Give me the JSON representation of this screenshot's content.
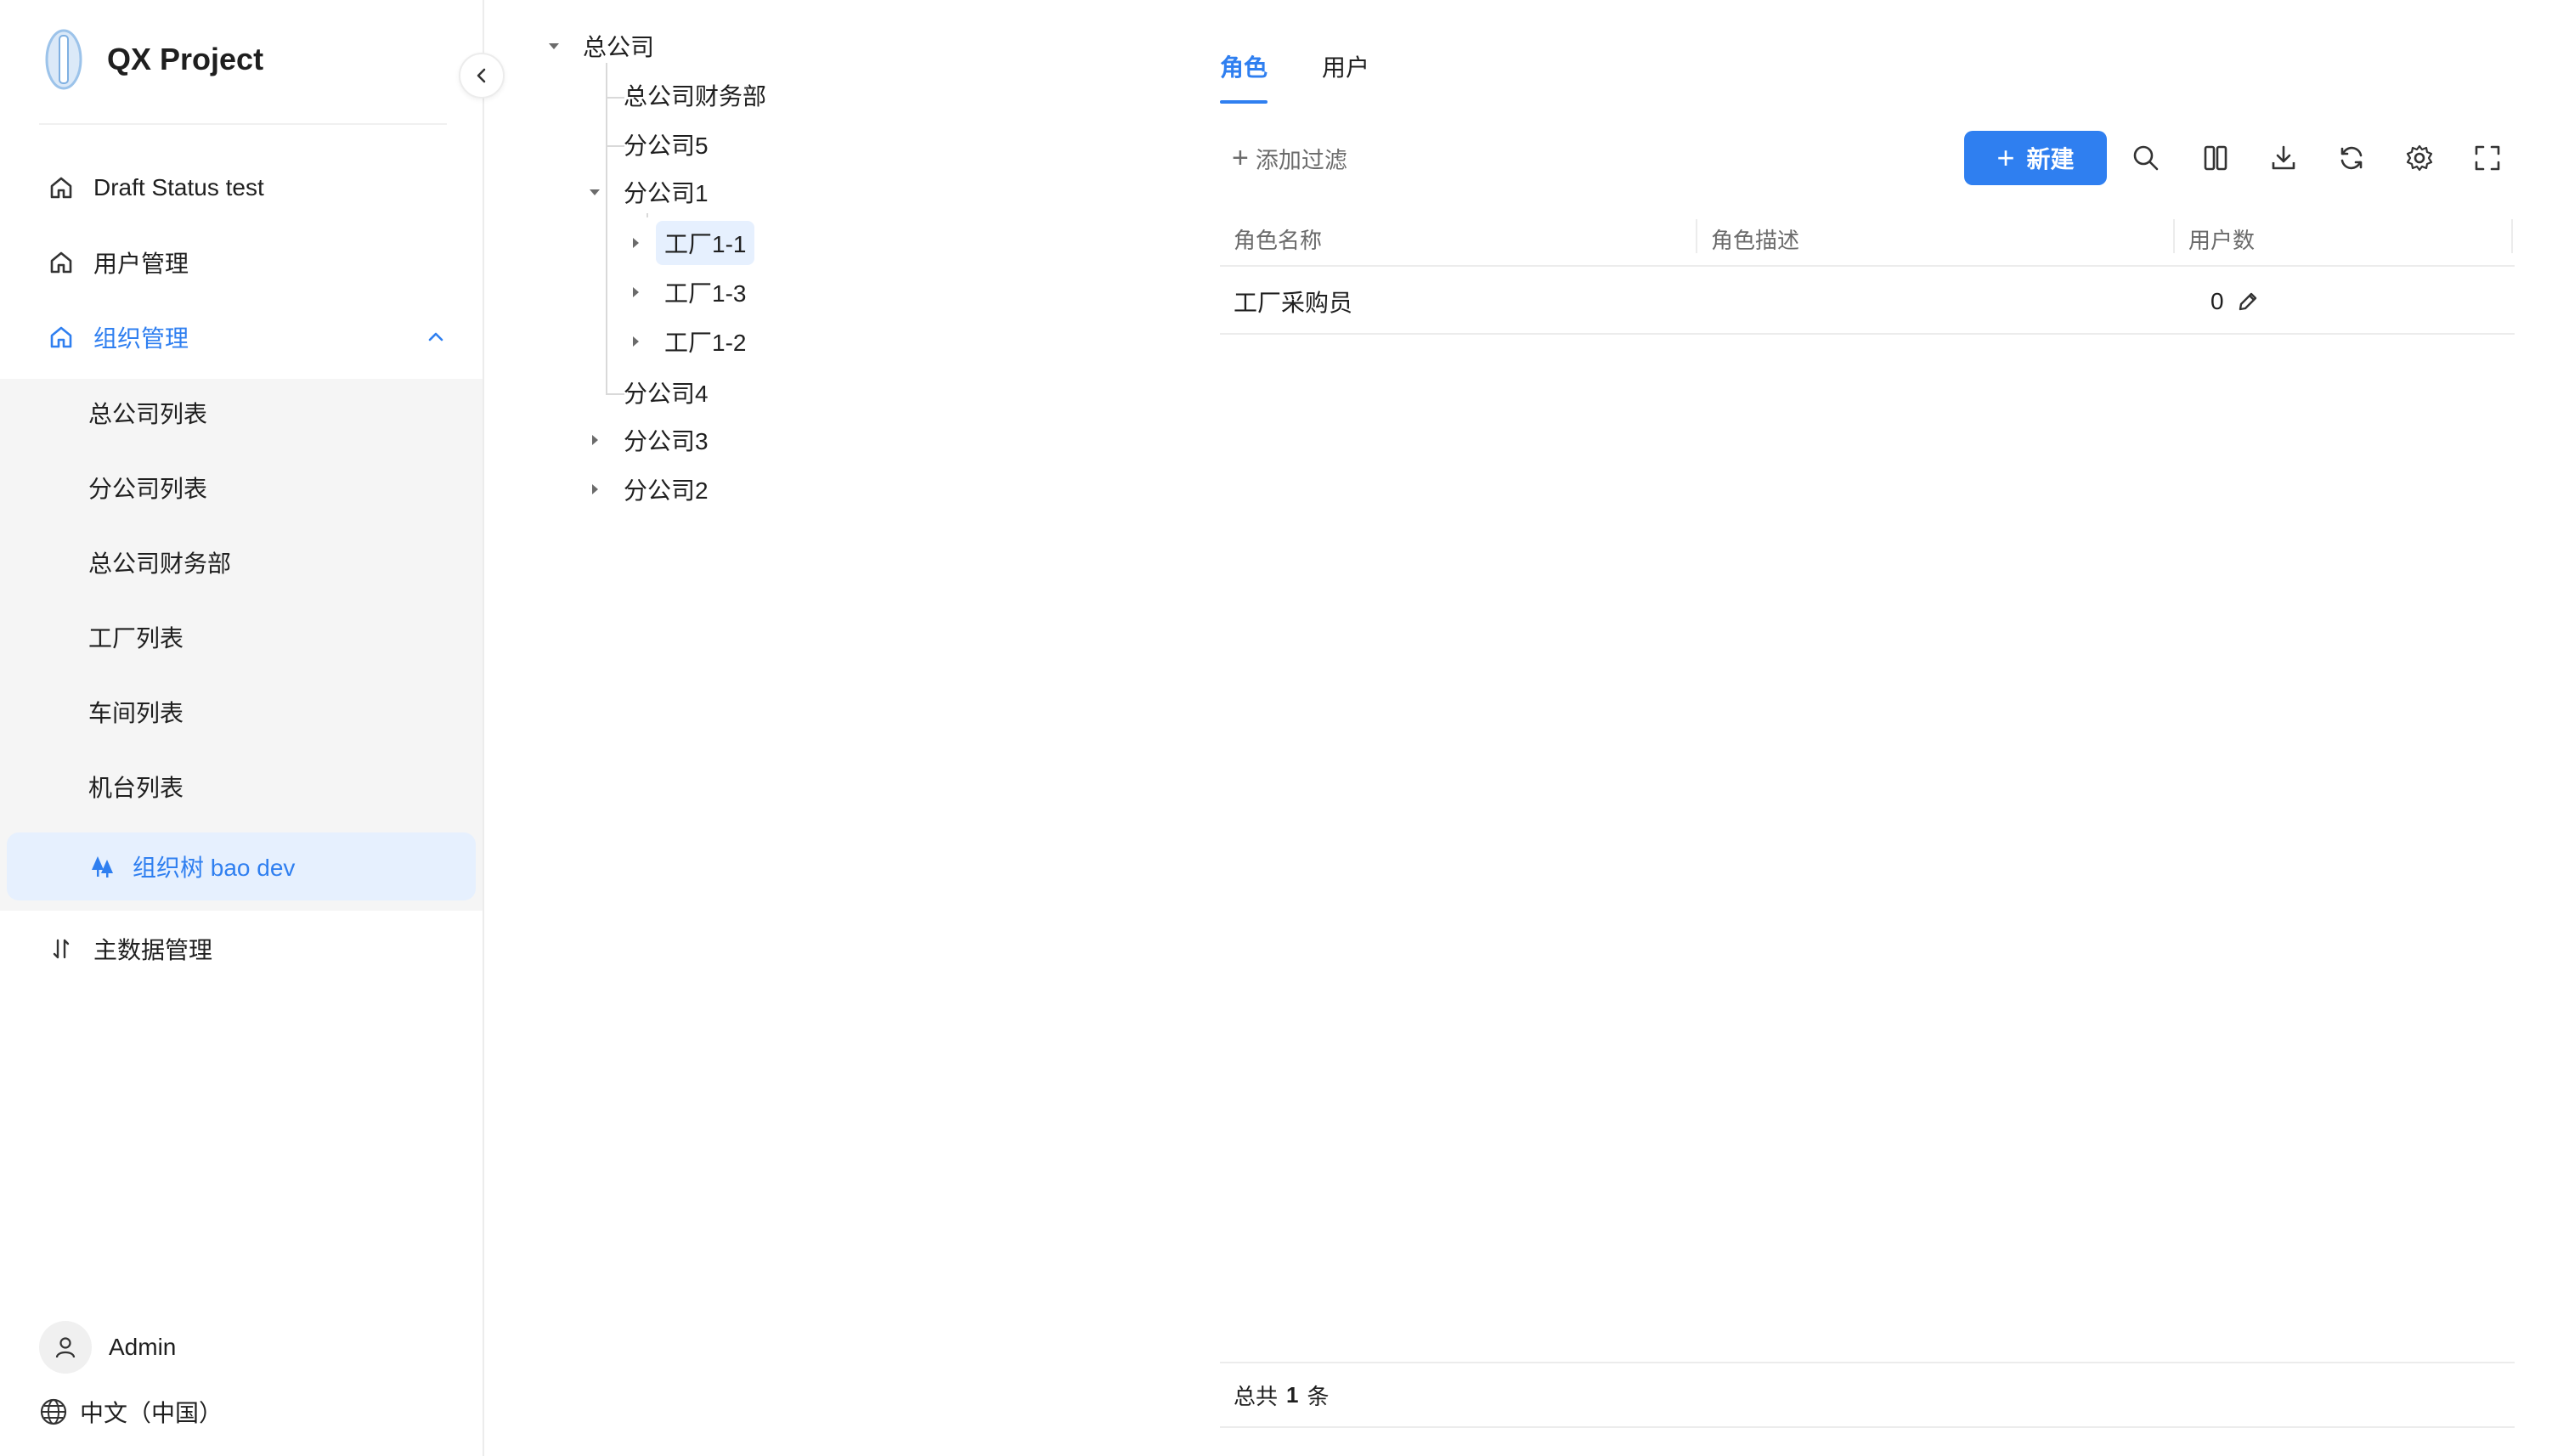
{
  "app": {
    "title": "QX Project"
  },
  "sidebar": {
    "menu": [
      {
        "label": "Draft Status test",
        "icon": "home-icon"
      },
      {
        "label": "用户管理",
        "icon": "home-icon"
      },
      {
        "label": "组织管理",
        "icon": "home-icon",
        "expanded": true
      }
    ],
    "submenu": [
      {
        "label": "总公司列表"
      },
      {
        "label": "分公司列表"
      },
      {
        "label": "总公司财务部"
      },
      {
        "label": "工厂列表"
      },
      {
        "label": "车间列表"
      },
      {
        "label": "机台列表"
      },
      {
        "label": "组织树 bao dev",
        "icon": "tree-icon",
        "selected": true
      }
    ],
    "master_data": {
      "label": "主数据管理",
      "icon": "sort-icon"
    },
    "user": {
      "name": "Admin"
    },
    "language": {
      "label": "中文（中国）"
    }
  },
  "tree": {
    "nodes": [
      {
        "label": "总公司",
        "level": 0,
        "state": "expanded"
      },
      {
        "label": "总公司财务部",
        "level": 1,
        "state": "leaf"
      },
      {
        "label": "分公司5",
        "level": 1,
        "state": "leaf"
      },
      {
        "label": "分公司1",
        "level": 1,
        "state": "expanded"
      },
      {
        "label": "工厂1-1",
        "level": 2,
        "state": "collapsed",
        "selected": true
      },
      {
        "label": "工厂1-3",
        "level": 2,
        "state": "collapsed"
      },
      {
        "label": "工厂1-2",
        "level": 2,
        "state": "collapsed"
      },
      {
        "label": "分公司4",
        "level": 1,
        "state": "leaf"
      },
      {
        "label": "分公司3",
        "level": 1,
        "state": "collapsed"
      },
      {
        "label": "分公司2",
        "level": 1,
        "state": "collapsed"
      }
    ]
  },
  "main": {
    "tabs": [
      {
        "label": "角色",
        "active": true
      },
      {
        "label": "用户",
        "active": false
      }
    ],
    "toolbar": {
      "filter_label": "添加过滤",
      "new_label": "新建",
      "icons": [
        "search-icon",
        "columns-icon",
        "download-icon",
        "refresh-icon",
        "settings-icon",
        "fullscreen-icon"
      ]
    },
    "table": {
      "columns": [
        "角色名称",
        "角色描述",
        "用户数"
      ],
      "rows": [
        {
          "name": "工厂采购员",
          "description": "",
          "user_count": "0"
        }
      ]
    },
    "footer": {
      "prefix": "总共",
      "total": "1",
      "suffix": "条"
    }
  },
  "colors": {
    "accent": "#2f7ff0",
    "selected_bg": "#e6f0fe",
    "submenu_bg": "#f5f5f5"
  }
}
